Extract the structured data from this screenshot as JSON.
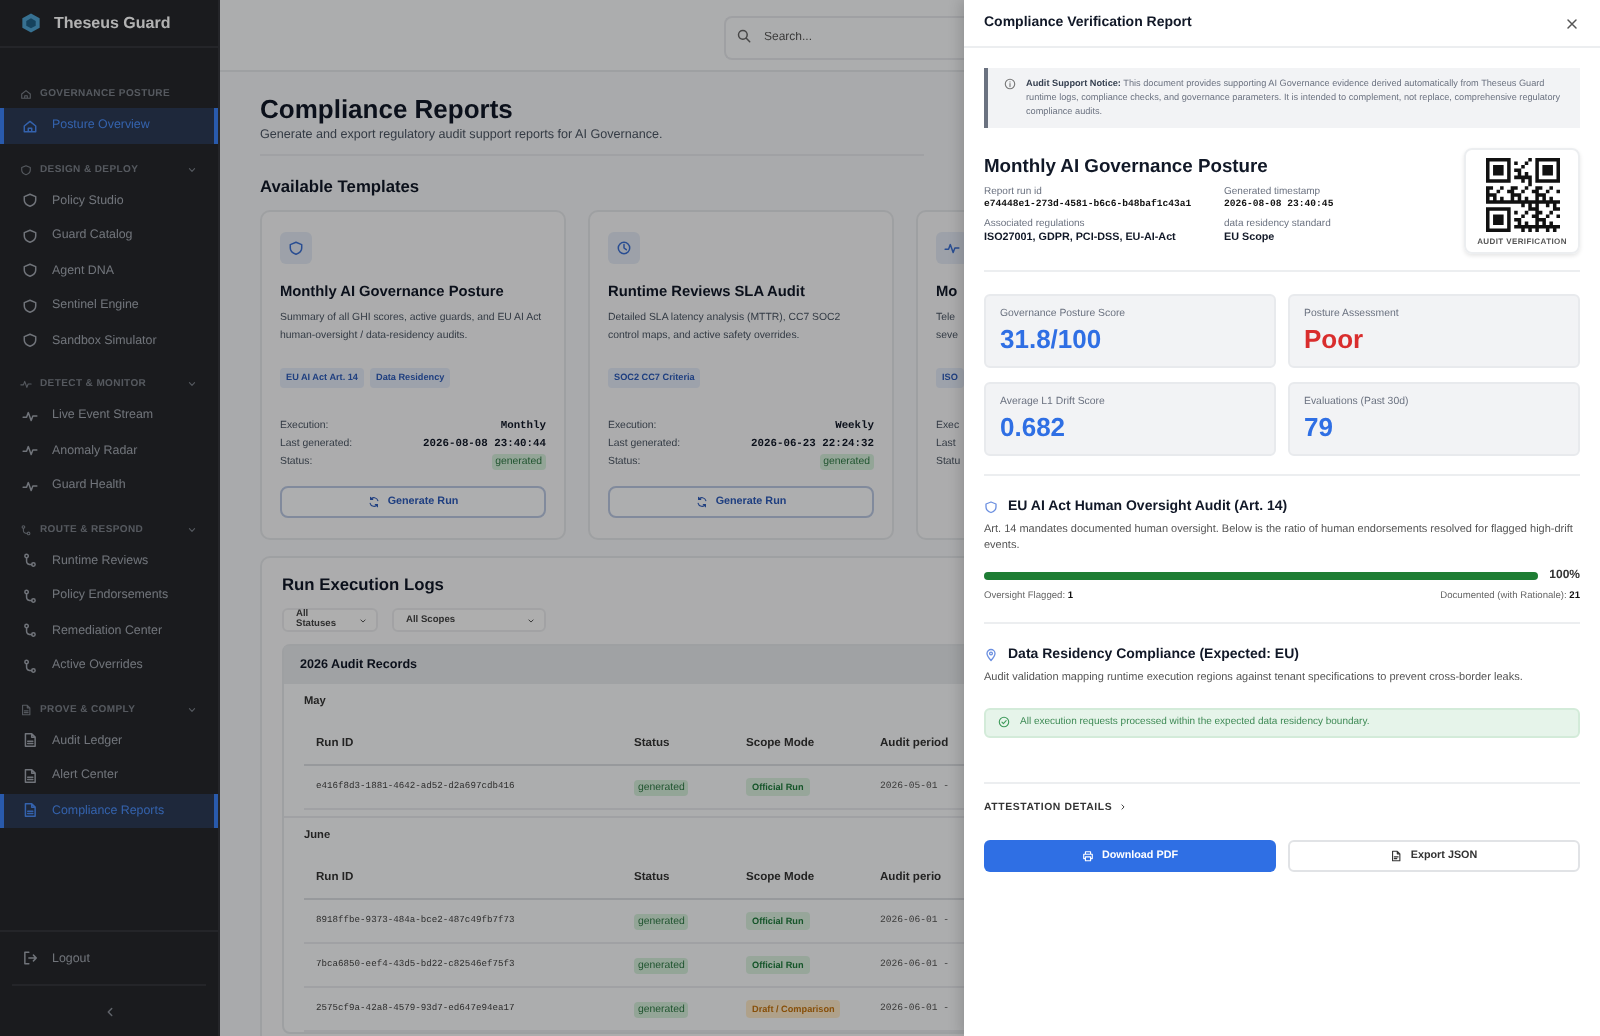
{
  "sidebar": {
    "brand": "Theseus Guard",
    "sections": [
      {
        "title": "GOVERNANCE POSTURE",
        "kind": "home",
        "items": [
          {
            "label": "Posture Overview",
            "selected": true
          }
        ]
      },
      {
        "title": "DESIGN & DEPLOY",
        "kind": "shield",
        "expanded": true,
        "items": [
          {
            "label": "Policy Studio",
            "selected": false
          },
          {
            "label": "Guard Catalog",
            "selected": false
          },
          {
            "label": "Agent DNA",
            "selected": false
          },
          {
            "label": "Sentinel Engine",
            "selected": false
          },
          {
            "label": "Sandbox Simulator",
            "selected": false
          }
        ]
      },
      {
        "title": "DETECT & MONITOR",
        "kind": "pulse",
        "expanded": true,
        "items": [
          {
            "label": "Live Event Stream",
            "selected": false
          },
          {
            "label": "Anomaly Radar",
            "selected": false
          },
          {
            "label": "Guard Health",
            "selected": false
          }
        ]
      },
      {
        "title": "ROUTE & RESPOND",
        "kind": "route",
        "expanded": true,
        "items": [
          {
            "label": "Runtime Reviews",
            "selected": false
          },
          {
            "label": "Policy Endorsements",
            "selected": false
          },
          {
            "label": "Remediation Center",
            "selected": false
          },
          {
            "label": "Active Overrides",
            "selected": false
          }
        ]
      },
      {
        "title": "PROVE & COMPLY",
        "kind": "file",
        "expanded": true,
        "items": [
          {
            "label": "Audit Ledger",
            "selected": false
          },
          {
            "label": "Alert Center",
            "selected": false
          },
          {
            "label": "Compliance Reports",
            "selected": true
          }
        ]
      }
    ],
    "logout": "Logout"
  },
  "search": {
    "placeholder": "Search..."
  },
  "page": {
    "title": "Compliance Reports",
    "subtitle": "Generate and export regulatory audit support reports for AI Governance."
  },
  "templates": {
    "heading": "Available Templates",
    "cards": [
      {
        "kind": "shield",
        "title": "Monthly AI Governance Posture",
        "description": "Summary of all GHI scores, active guards, and EU AI Act human-oversight / data-residency audits.",
        "tags": [
          "EU AI Act Art. 14",
          "Data Residency"
        ],
        "rows": [
          {
            "label": "Execution:",
            "value": "Monthly",
            "kind": "text"
          },
          {
            "label": "Last generated:",
            "value": "2026-08-08 23:40:44",
            "kind": "text"
          },
          {
            "label": "Status:",
            "value": "generated",
            "kind": "status"
          }
        ],
        "button": "Generate Run"
      },
      {
        "kind": "clock",
        "title": "Runtime Reviews SLA Audit",
        "description": "Detailed SLA latency analysis (MTTR), CC7 SOC2 control maps, and active safety overrides.",
        "tags": [
          "SOC2 CC7 Criteria"
        ],
        "rows": [
          {
            "label": "Execution:",
            "value": "Weekly",
            "kind": "text"
          },
          {
            "label": "Last generated:",
            "value": "2026-06-23 22:24:32",
            "kind": "text"
          },
          {
            "label": "Status:",
            "value": "generated",
            "kind": "status"
          }
        ],
        "button": "Generate Run"
      },
      {
        "kind": "pulse",
        "title": "Mo",
        "description": "Tele\nseve",
        "tags": [
          "ISO"
        ],
        "rows": [
          {
            "label": "Exec"
          },
          {
            "label": "Last"
          },
          {
            "label": "Statu"
          }
        ]
      }
    ]
  },
  "logs": {
    "heading": "Run Execution Logs",
    "filters": [
      "All Statuses",
      "All Scopes"
    ],
    "group": "2026 Audit Records",
    "months": [
      {
        "name": "May",
        "columns": [
          "Run ID",
          "Status",
          "Scope Mode",
          "Audit period"
        ],
        "rows": [
          {
            "run_id": "e416f8d3-1881-4642-ad52-d2a697cdb416",
            "status": "generated",
            "scope": "Official Run",
            "kind": "official",
            "period": "2026-05-01 -"
          }
        ]
      },
      {
        "name": "June",
        "columns": [
          "Run ID",
          "Status",
          "Scope Mode",
          "Audit perio"
        ],
        "rows": [
          {
            "run_id": "8918ffbe-9373-484a-bce2-487c49fb7f73",
            "status": "generated",
            "scope": "Official Run",
            "kind": "official",
            "period": "2026-06-01 -"
          },
          {
            "run_id": "7bca6850-eef4-43d5-bd22-c82546ef75f3",
            "status": "generated",
            "scope": "Official Run",
            "kind": "official",
            "period": "2026-06-01 -"
          },
          {
            "run_id": "2575cf9a-42a8-4579-93d7-ed647e94ea17",
            "status": "generated",
            "scope": "Draft / Comparison",
            "kind": "draft",
            "period": "2026-06-01 -"
          }
        ]
      }
    ]
  },
  "drawer": {
    "title": "Compliance Verification Report",
    "notice": "**Audit Support Notice:** This document provides supporting AI Governance evidence derived automatically from Theseus Guard runtime logs, compliance checks, and governance parameters. It is intended to complement, not replace, comprehensive regulatory compliance audits.",
    "report_title": "Monthly AI Governance Posture",
    "meta": [
      {
        "label": "Report run id",
        "value": "e74448e1-273d-4581-b6c6-b48baf1c43a1",
        "kind": "mono"
      },
      {
        "label": "Generated timestamp",
        "value": "2026-08-08 23:40:45",
        "kind": "mono"
      },
      {
        "label": "Associated regulations",
        "value": "ISO27001, GDPR, PCI-DSS, EU-AI-Act",
        "kind": "text"
      },
      {
        "label": "data residency standard",
        "value": "EU Scope",
        "kind": "text"
      }
    ],
    "qr_caption": "AUDIT VERIFICATION",
    "stats": [
      {
        "label": "Governance Posture Score",
        "value": "31.8/100",
        "kind": "info"
      },
      {
        "label": "Posture Assessment",
        "value": "Poor",
        "kind": "danger"
      },
      {
        "label": "Average L1 Drift Score",
        "value": "0.682",
        "kind": "info"
      },
      {
        "label": "Evaluations (Past 30d)",
        "value": "79",
        "kind": "info"
      }
    ],
    "oversight": {
      "title": "EU AI Act Human Oversight Audit (Art. 14)",
      "text": "Art. 14 mandates documented human oversight. Below is the ratio of human endorsements resolved for flagged high-drift events.",
      "level": 1,
      "reading": "100%",
      "flagged": "Oversight Flagged: **1**",
      "documented": "Documented (with Rationale): **21**"
    },
    "residency": {
      "title": "Data Residency Compliance (Expected: EU)",
      "text": "Audit validation mapping runtime execution regions against tenant specifications to prevent cross-border leaks.",
      "alert": "All execution requests processed within the expected data residency boundary."
    },
    "attestation": {
      "label": "ATTESTATION DETAILS",
      "expanded": false
    },
    "buttons": [
      {
        "label": "Download PDF",
        "kind": "primary"
      },
      {
        "label": "Export JSON",
        "kind": "secondary"
      }
    ]
  }
}
